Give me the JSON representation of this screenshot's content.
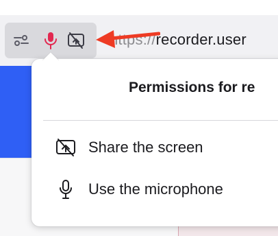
{
  "url_bar": {
    "scheme": "https://",
    "domain": "recorder",
    "rest": ".user"
  },
  "permissions_panel": {
    "title": "Permissions for re",
    "items": [
      {
        "label": "Share the screen",
        "icon": "screen-share-blocked-icon"
      },
      {
        "label": "Use the microphone",
        "icon": "microphone-icon"
      }
    ]
  },
  "toolbar_icons": [
    "tracking-protection-icon",
    "microphone-active-icon",
    "screen-share-blocked-icon"
  ],
  "colors": {
    "mic_active": "#e22850",
    "arrow": "#ee3b24",
    "page_blue": "#2f5ff5"
  }
}
